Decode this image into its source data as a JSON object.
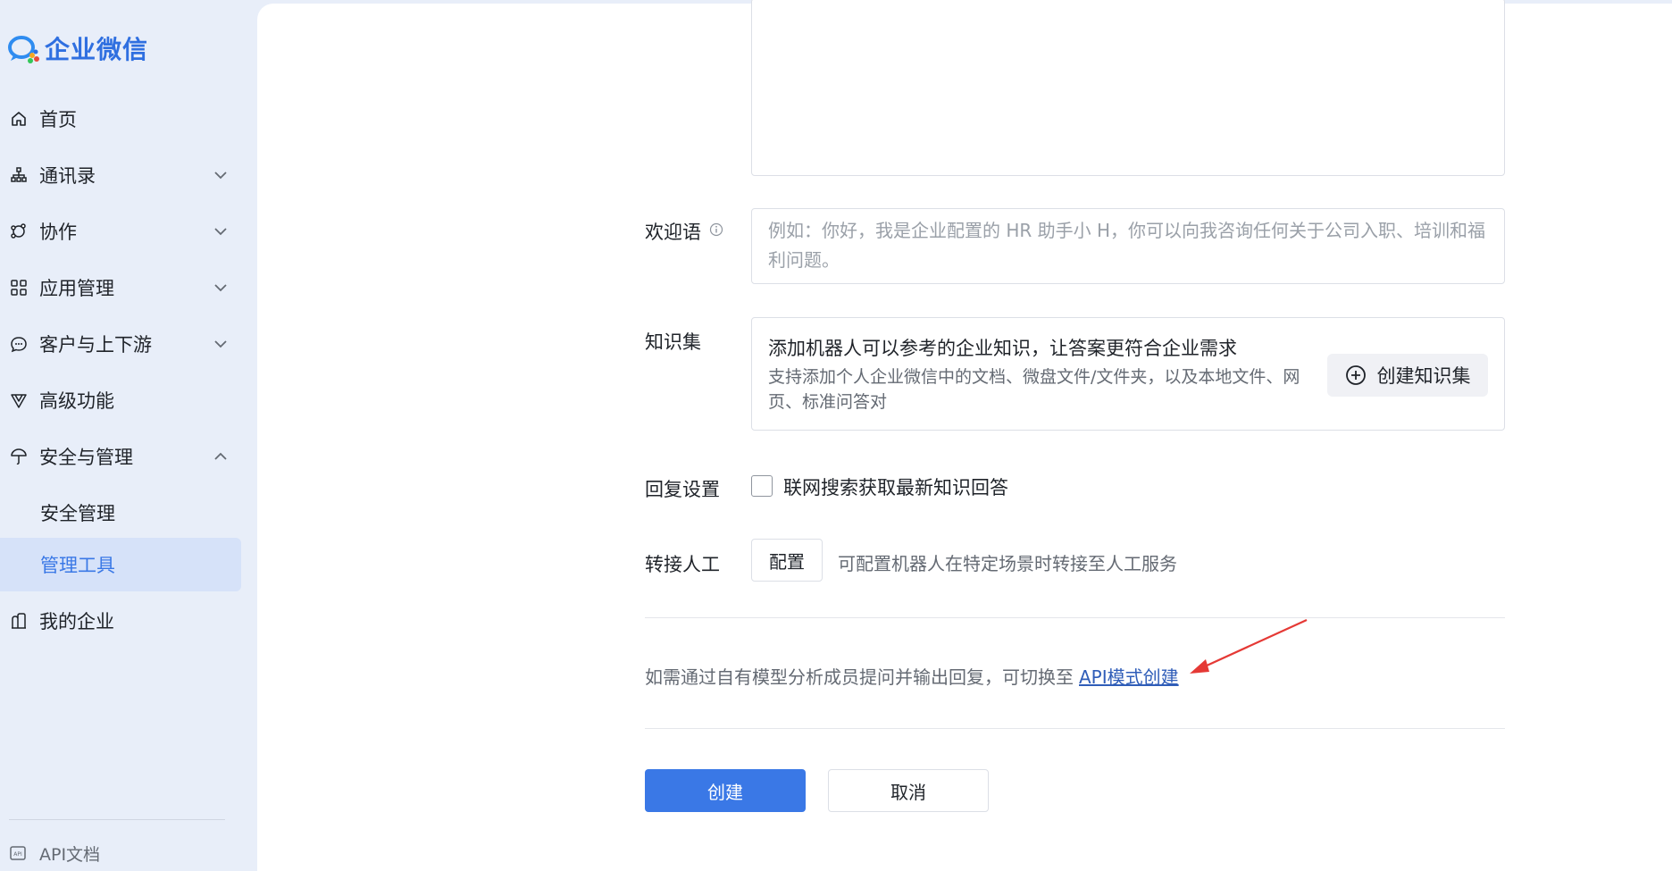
{
  "brand": {
    "name": "企业微信",
    "color": "#2f6fe0"
  },
  "sidebar": {
    "items": [
      {
        "label": "首页",
        "icon": "home-icon",
        "expandable": false
      },
      {
        "label": "通讯录",
        "icon": "contacts-icon",
        "expandable": true
      },
      {
        "label": "协作",
        "icon": "collaboration-icon",
        "expandable": true
      },
      {
        "label": "应用管理",
        "icon": "apps-grid-icon",
        "expandable": true
      },
      {
        "label": "客户与上下游",
        "icon": "chat-bubble-icon",
        "expandable": true
      },
      {
        "label": "高级功能",
        "icon": "advanced-icon",
        "expandable": false
      },
      {
        "label": "安全与管理",
        "icon": "umbrella-icon",
        "expandable": true,
        "expanded": true
      },
      {
        "label": "安全管理",
        "sub": true
      },
      {
        "label": "管理工具",
        "sub": true,
        "active": true
      },
      {
        "label": "我的企业",
        "icon": "building-icon",
        "expandable": false
      }
    ],
    "footer": {
      "label": "API文档",
      "icon": "api-doc-icon"
    }
  },
  "form": {
    "welcome": {
      "label": "欢迎语",
      "placeholder": "例如：你好，我是企业配置的 HR 助手小 H，你可以向我咨询任何关于公司入职、培训和福利问题。"
    },
    "knowledge": {
      "label": "知识集",
      "title": "添加机器人可以参考的企业知识，让答案更符合企业需求",
      "desc": "支持添加个人企业微信中的文档、微盘文件/文件夹，以及本地文件、网页、标准问答对",
      "button": "创建知识集"
    },
    "reply": {
      "label": "回复设置",
      "checkbox_label": "联网搜索获取最新知识回答",
      "checked": false
    },
    "handoff": {
      "label": "转接人工",
      "button": "配置",
      "hint": "可配置机器人在特定场景时转接至人工服务"
    },
    "api_switch": {
      "text": "如需通过自有模型分析成员提问并输出回复，可切换至",
      "link": "API模式创建"
    },
    "actions": {
      "create": "创建",
      "cancel": "取消"
    }
  },
  "colors": {
    "accent": "#3a78e6",
    "annotation": "#e53935"
  }
}
